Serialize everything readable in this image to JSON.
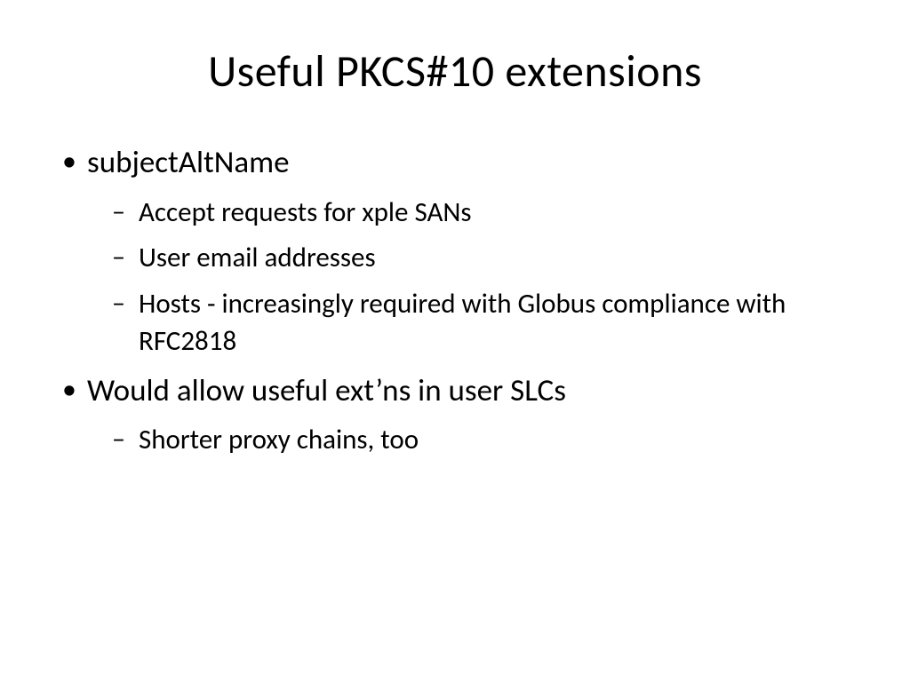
{
  "title": "Useful PKCS#10 extensions",
  "bullets": [
    {
      "text": "subjectAltName",
      "sub": [
        "Accept requests for xple SANs",
        "User email addresses",
        "Hosts - increasingly required with Globus compliance with RFC2818"
      ]
    },
    {
      "text": "Would allow useful ext’ns in user SLCs",
      "sub": [
        "Shorter proxy chains, too"
      ]
    }
  ]
}
